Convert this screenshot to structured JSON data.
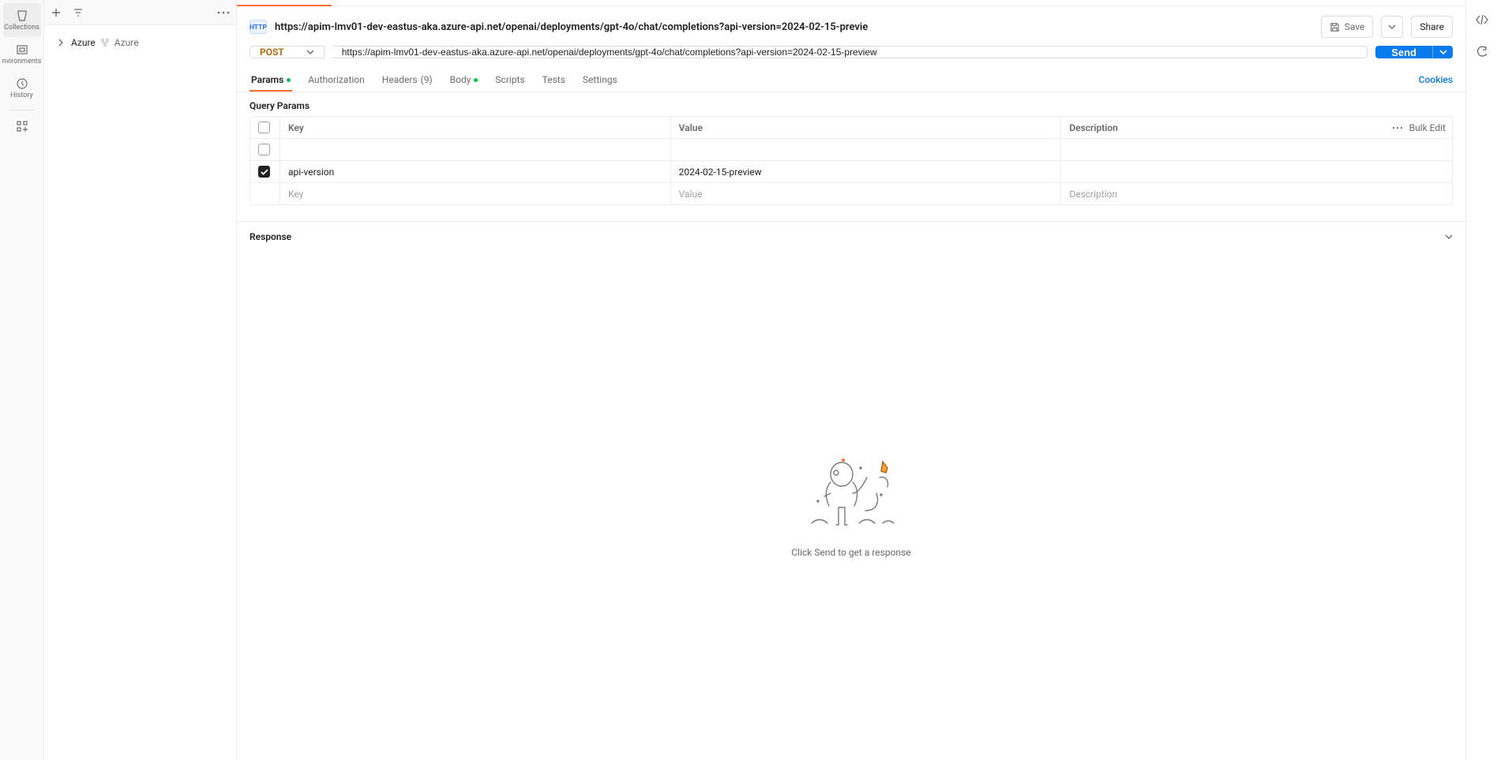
{
  "rail": {
    "collections": "Collections",
    "environments": "nvironments",
    "history": "History"
  },
  "sidebar": {
    "tree": {
      "root_label": "Azure",
      "sub_label": "Azure"
    }
  },
  "header": {
    "http_badge": "HTTP",
    "title": "https://apim-lmv01-dev-eastus-aka.azure-api.net/openai/deployments/gpt-4o/chat/completions?api-version=2024-02-15-previe",
    "save": "Save",
    "share": "Share"
  },
  "request": {
    "method": "POST",
    "url": "https://apim-lmv01-dev-eastus-aka.azure-api.net/openai/deployments/gpt-4o/chat/completions?api-version=2024-02-15-preview",
    "send": "Send"
  },
  "cfg_tabs": {
    "params": "Params",
    "authorization": "Authorization",
    "headers": "Headers",
    "headers_count": "(9)",
    "body": "Body",
    "scripts": "Scripts",
    "tests": "Tests",
    "settings": "Settings",
    "cookies": "Cookies"
  },
  "params": {
    "heading": "Query Params",
    "cols": {
      "key": "Key",
      "value": "Value",
      "description": "Description"
    },
    "bulk_edit": "Bulk Edit",
    "rows": [
      {
        "checked": false,
        "key": "",
        "value": "",
        "description": ""
      },
      {
        "checked": true,
        "key": "api-version",
        "value": "2024-02-15-preview",
        "description": ""
      }
    ],
    "placeholders": {
      "key": "Key",
      "value": "Value",
      "description": "Description"
    }
  },
  "response": {
    "label": "Response",
    "empty_hint": "Click Send to get a response"
  }
}
